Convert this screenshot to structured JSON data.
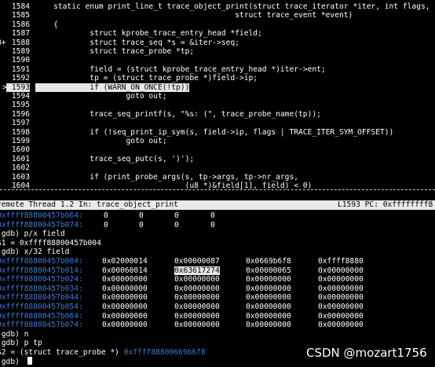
{
  "source": {
    "lines": [
      {
        "num": "1584",
        "prefix": "",
        "code": "    static enum print_line_t trace_object_print(struct trace_iterator *iter, int flags,"
      },
      {
        "num": "1585",
        "prefix": "",
        "code": "                                            struct trace_event *event)"
      },
      {
        "num": "1586",
        "prefix": "",
        "code": "    {"
      },
      {
        "num": "1587",
        "prefix": "",
        "code": "            struct kprobe_trace_entry_head *field;"
      },
      {
        "num": "1588",
        "prefix": "B+",
        "code": "            struct trace_seq *s = &iter->seq;"
      },
      {
        "num": "1589",
        "prefix": "",
        "code": "            struct trace_probe *tp;"
      },
      {
        "num": "1590",
        "prefix": "",
        "code": ""
      },
      {
        "num": "1591",
        "prefix": "",
        "code": "            field = (struct kprobe_trace_entry_head *)iter->ent;"
      },
      {
        "num": "1592",
        "prefix": "",
        "code": "            tp = (struct trace_probe *)field->ip;"
      },
      {
        "num": "1593",
        "prefix": ">",
        "code": "            if (WARN_ON_ONCE(!tp))"
      },
      {
        "num": "1594",
        "prefix": "",
        "code": "                    goto out;"
      },
      {
        "num": "1595",
        "prefix": "",
        "code": ""
      },
      {
        "num": "1596",
        "prefix": "",
        "code": "            trace_seq_printf(s, \"%s: (\", trace_probe_name(tp));"
      },
      {
        "num": "1597",
        "prefix": "",
        "code": ""
      },
      {
        "num": "1598",
        "prefix": "",
        "code": "            if (!seq_print_ip_sym(s, field->ip, flags | TRACE_ITER_SYM_OFFSET))"
      },
      {
        "num": "1599",
        "prefix": "",
        "code": "                    goto out;"
      },
      {
        "num": "1600",
        "prefix": "",
        "code": ""
      },
      {
        "num": "1601",
        "prefix": "",
        "code": "            trace_seq_putc(s, ')');"
      },
      {
        "num": "1602",
        "prefix": "",
        "code": ""
      },
      {
        "num": "1603",
        "prefix": "",
        "code": "            if (print_probe_args(s, tp->args, tp->nr_args,"
      },
      {
        "num": "1604",
        "prefix": "",
        "code": "                                 (u8 *)&field[1], field) < 0)"
      }
    ],
    "current_line": "1593"
  },
  "status": {
    "left": "remote Thread 1.2 In: trace_object_print",
    "right": "L1593 PC: 0xffffffff8"
  },
  "console": {
    "pre_rows": [
      {
        "addr": "0xffff88800457b064:",
        "vals": [
          "0",
          "0",
          "0",
          "0"
        ]
      },
      {
        "addr": "0xffff88800457b074:",
        "vals": [
          "0",
          "0",
          "0",
          "0"
        ]
      }
    ],
    "cmd1": "(gdb) p/x field",
    "res1": "$1 = 0xffff88800457b004",
    "cmd2": "(gdb) x/32 field",
    "mem_rows": [
      {
        "addr": "0xffff88800457b004:",
        "vals": [
          "0x02000014",
          "0x00000087",
          "0x0669b6f8",
          "0xffff8880"
        ],
        "hl": -1
      },
      {
        "addr": "0xffff88800457b014:",
        "vals": [
          "0x00060014",
          "0x63617274",
          "0x00000065",
          "0x00000000"
        ],
        "hl": 1
      },
      {
        "addr": "0xffff88800457b024:",
        "vals": [
          "0x00000000",
          "0x00000000",
          "0x00000000",
          "0x00000000"
        ],
        "hl": -1
      },
      {
        "addr": "0xffff88800457b034:",
        "vals": [
          "0x00000000",
          "0x00000000",
          "0x00000000",
          "0x00000000"
        ],
        "hl": -1
      },
      {
        "addr": "0xffff88800457b044:",
        "vals": [
          "0x00000000",
          "0x00000000",
          "0x00000000",
          "0x00000000"
        ],
        "hl": -1
      },
      {
        "addr": "0xffff88800457b054:",
        "vals": [
          "0x00000000",
          "0x00000000",
          "0x00000000",
          "0x00000000"
        ],
        "hl": -1
      },
      {
        "addr": "0xffff88800457b064:",
        "vals": [
          "0x00000000",
          "0x00000000",
          "0x00000000",
          "0x00000000"
        ],
        "hl": -1
      },
      {
        "addr": "0xffff88800457b074:",
        "vals": [
          "0x00000000",
          "0x00000000",
          "0x00000000",
          "0x00000000"
        ],
        "hl": -1
      }
    ],
    "cmd3": "(gdb) n",
    "cmd4": "(gdb) p tp",
    "res4_prefix": "$2 = (struct trace_probe *) ",
    "res4_addr": "0xffff88800669b6f8",
    "prompt": "(gdb) "
  },
  "watermark": "CSDN @mozart1756",
  "colors": {
    "address": "#3a7bd5",
    "highlight_bg": "#e6e6e6",
    "status_bg": "#e9e9e9"
  }
}
